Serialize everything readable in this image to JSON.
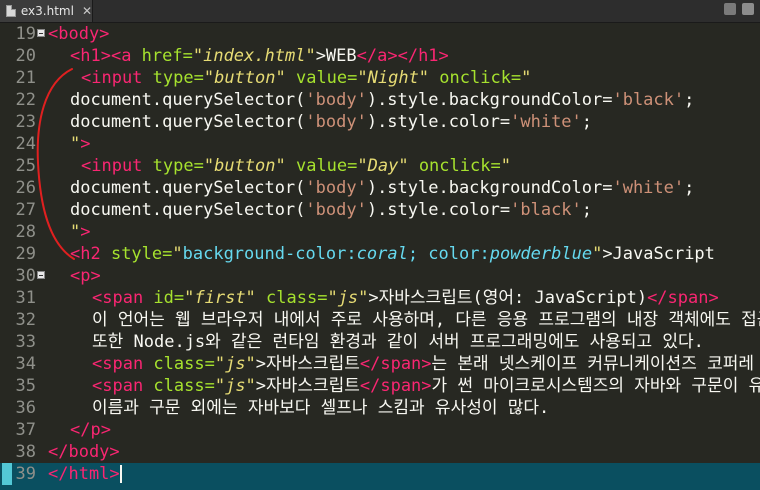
{
  "tab": {
    "filename": "ex3.html",
    "close": "✕"
  },
  "lines": [
    {
      "n": "19"
    },
    {
      "n": "20"
    },
    {
      "n": "21"
    },
    {
      "n": "22"
    },
    {
      "n": "23"
    },
    {
      "n": "24"
    },
    {
      "n": "25"
    },
    {
      "n": "26"
    },
    {
      "n": "27"
    },
    {
      "n": "28"
    },
    {
      "n": "29"
    },
    {
      "n": "30"
    },
    {
      "n": "31"
    },
    {
      "n": "32"
    },
    {
      "n": "33"
    },
    {
      "n": "34"
    },
    {
      "n": "35"
    },
    {
      "n": "36"
    },
    {
      "n": "37"
    },
    {
      "n": "38"
    },
    {
      "n": "39"
    }
  ],
  "code": {
    "l19": [
      "<body>"
    ],
    "l20": [
      "<h1>",
      "<a",
      " href=",
      "\"index.html\"",
      ">WEB",
      "</a>",
      "</h1>"
    ],
    "l21": [
      "<input",
      " type=",
      "\"button\"",
      " value=",
      "\"Night\"",
      " onclick=",
      "\""
    ],
    "l22": [
      "document.querySelector(",
      "'body'",
      ").style.backgroundColor=",
      "'black'",
      ";"
    ],
    "l23": [
      "document.querySelector(",
      "'body'",
      ").style.color=",
      "'white'",
      ";"
    ],
    "l24": [
      "\"",
      ">"
    ],
    "l25": [
      "<input",
      " type=",
      "\"button\"",
      " value=",
      "\"Day\"",
      " onclick=",
      "\""
    ],
    "l26": [
      "document.querySelector(",
      "'body'",
      ").style.backgroundColor=",
      "'white'",
      ";"
    ],
    "l27": [
      "document.querySelector(",
      "'body'",
      ").style.color=",
      "'black'",
      ";"
    ],
    "l28": [
      "\"",
      ">"
    ],
    "l29": [
      "<h2",
      " style=",
      "\"",
      "background-color:",
      "coral",
      "; color:",
      "powderblue",
      "\"",
      ">JavaScript"
    ],
    "l30": [
      "<p>"
    ],
    "l31": [
      "<span",
      " id=",
      "\"first\"",
      " class=",
      "\"js\"",
      ">자바스크립트(영어: JavaScript)",
      "</span>"
    ],
    "l32": [
      "이 언어는 웹 브라우저 내에서 주로 사용하며, 다른 응용 프로그램의 내장 객체에도 접근할"
    ],
    "l33": [
      "또한 Node.js와 같은 런타임 환경과 같이 서버 프로그래밍에도 사용되고 있다."
    ],
    "l34": [
      "<span",
      " class=",
      "\"js\"",
      ">자바스크립트",
      "</span>",
      "는 본래 넷스케이프 커뮤니케이션즈 코퍼레"
    ],
    "l35": [
      "<span",
      " class=",
      "\"js\"",
      ">자바스크립트",
      "</span>",
      "가 썬 마이크로시스템즈의 자바와 구문이 유"
    ],
    "l36": [
      "이름과 구문 외에는 자바보다 셀프나 스킴과 유사성이 많다."
    ],
    "l37": [
      "</p>"
    ],
    "l38": [
      "</body>"
    ],
    "l39": [
      "</html>"
    ]
  }
}
